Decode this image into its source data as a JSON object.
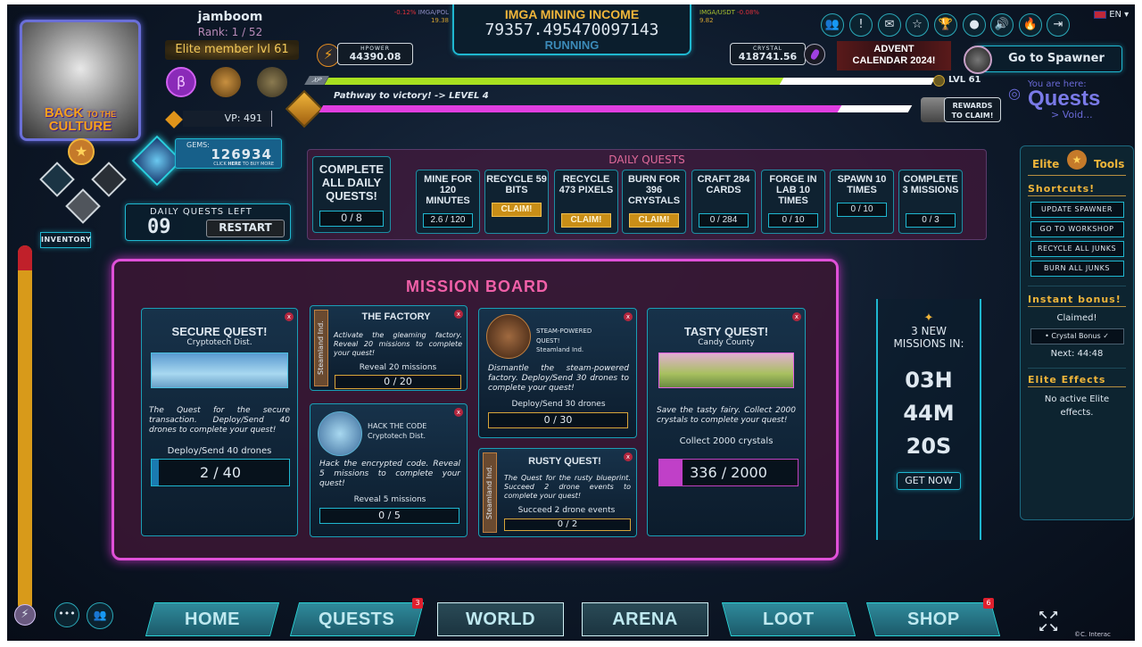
{
  "player": {
    "name": "jamboom",
    "rank": "Rank: 1 / 52",
    "elite": "Elite member lvl 61",
    "vp": "VP: 491",
    "avatar_logo": "BACK TO THE CULTURE"
  },
  "tickers": {
    "pol_change": "-0.12%",
    "pol_pair": "IMGA/POL",
    "pol_value": "19.38",
    "usdt_pair": "IMGA/USDT",
    "usdt_change": "-0.08%",
    "usdt_value": "9.82"
  },
  "income": {
    "title": "IMGA MINING INCOME",
    "value": "79357.495470097143",
    "status": "RUNNING"
  },
  "hpower": {
    "label": "HPOWER",
    "value": "44390.08"
  },
  "crystal": {
    "label": "CRYSTAL",
    "value": "418741.56"
  },
  "advent": {
    "line1": "ADVENT",
    "line2": "CALENDAR 2024!"
  },
  "spawner": {
    "label": "Go to Spawner"
  },
  "top_icons": [
    "friends-icon",
    "alert-icon",
    "mail-icon",
    "star-icon",
    "trophy-icon",
    "coins-icon",
    "sound-icon",
    "fire-icon",
    "logout-icon"
  ],
  "language": "EN",
  "xp": {
    "label": "XP",
    "fill_percent": 75,
    "level": "LVL 61"
  },
  "pathway": {
    "text": "Pathway to victory! -> LEVEL 4",
    "fill_percent": 88
  },
  "rewards": {
    "line1": "REWARDS",
    "line2": "TO CLAIM!"
  },
  "location": {
    "prefix": "You are here:",
    "page": "Quests",
    "sub": "> Void..."
  },
  "gems": {
    "label": "GEMS:",
    "value": "126934",
    "buy_prefix": "CLICK ",
    "buy_here": "HERE",
    "buy_suffix": " TO BUY MORE"
  },
  "inventory": {
    "label": "INVENTORY"
  },
  "daily_left": {
    "label": "DAILY QUESTS LEFT",
    "value": "09",
    "restart": "RESTART"
  },
  "daily_quests": {
    "title": "DAILY QUESTS",
    "all": {
      "label": "COMPLETE ALL DAILY QUESTS!",
      "progress": "0 / 8"
    },
    "items": [
      {
        "label": "MINE FOR 120 MINUTES",
        "progress": "2.6 / 120"
      },
      {
        "label": "RECYCLE 59 BITS",
        "claim": "CLAIM!"
      },
      {
        "label": "RECYCLE 473 PIXELS",
        "claim": "CLAIM!"
      },
      {
        "label": "BURN FOR 396 CRYSTALS",
        "claim": "CLAIM!"
      },
      {
        "label": "CRAFT 284 CARDS",
        "progress": "0 / 284"
      },
      {
        "label": "FORGE IN LAB 10 TIMES",
        "progress": "0 / 10"
      },
      {
        "label": "SPAWN 10 TIMES",
        "progress": "0 / 10"
      },
      {
        "label": "COMPLETE 3 MISSIONS",
        "progress": "0 / 3"
      }
    ]
  },
  "mission_board": {
    "title": "MISSION BOARD",
    "close": "x",
    "secure": {
      "title": "SECURE QUEST!",
      "district": "Cryptotech Dist.",
      "desc": "The Quest for the secure transaction. Deploy/Send 40 drones to complete your quest!",
      "goal": "Deploy/Send 40 drones",
      "progress": "2 / 40",
      "fill_percent": 5
    },
    "factory": {
      "side": "Steamland Ind.",
      "title": "THE FACTORY",
      "desc": "Activate the gleaming factory. Reveal 20 missions to complete your quest!",
      "goal": "Reveal 20 missions",
      "progress": "0 / 20"
    },
    "hack": {
      "title": "HACK THE CODE",
      "district": "Cryptotech Dist.",
      "desc": "Hack the encrypted code. Reveal 5 missions to complete your quest!",
      "goal": "Reveal 5 missions",
      "progress": "0 / 5"
    },
    "steam": {
      "title": "STEAM-POWERED QUEST!",
      "district": "Steamland Ind.",
      "desc": "Dismantle the steam-powered factory. Deploy/Send 30 drones to complete your quest!",
      "goal": "Deploy/Send 30 drones",
      "progress": "0 / 30"
    },
    "rusty": {
      "side": "Steamland Ind.",
      "title": "RUSTY QUEST!",
      "desc": "The Quest for the rusty blueprint. Succeed 2 drone events to complete your quest!",
      "goal": "Succeed 2 drone events",
      "progress": "0 / 2"
    },
    "tasty": {
      "title": "TASTY QUEST!",
      "district": "Candy County",
      "desc": "Save the tasty fairy. Collect 2000 crystals to complete your quest!",
      "goal": "Collect 2000 crystals",
      "progress": "336 / 2000",
      "fill_percent": 16.8
    }
  },
  "new_missions": {
    "label": "3 NEW MISSIONS IN:",
    "hours": "03H",
    "minutes": "44M",
    "seconds": "20S",
    "button": "GET NOW"
  },
  "elite_tools": {
    "title_left": "Elite",
    "title_right": "Tools",
    "shortcuts_title": "Shortcuts!",
    "shortcuts": [
      "UPDATE SPAWNER",
      "GO TO WORKSHOP",
      "RECYCLE ALL JUNKS",
      "BURN ALL JUNKS"
    ],
    "bonus_title": "Instant bonus!",
    "bonus_status": "Claimed!",
    "bonus_item": "• Crystal Bonus ✓",
    "bonus_next": "Next: 44:48",
    "effects_title": "Elite Effects",
    "effects_text": "No active Elite effects."
  },
  "nav": [
    {
      "label": "HOME"
    },
    {
      "label": "QUESTS",
      "badge": "3"
    },
    {
      "label": "WORLD"
    },
    {
      "label": "ARENA"
    },
    {
      "label": "LOOT"
    },
    {
      "label": "SHOP",
      "badge": "6"
    }
  ],
  "footer": {
    "copyright": "©C. Interac"
  },
  "colors": {
    "cyan": "#1fb7d0",
    "gold": "#f0b53a",
    "magenta": "#e03ee0",
    "xp_green": "#a8e020"
  }
}
